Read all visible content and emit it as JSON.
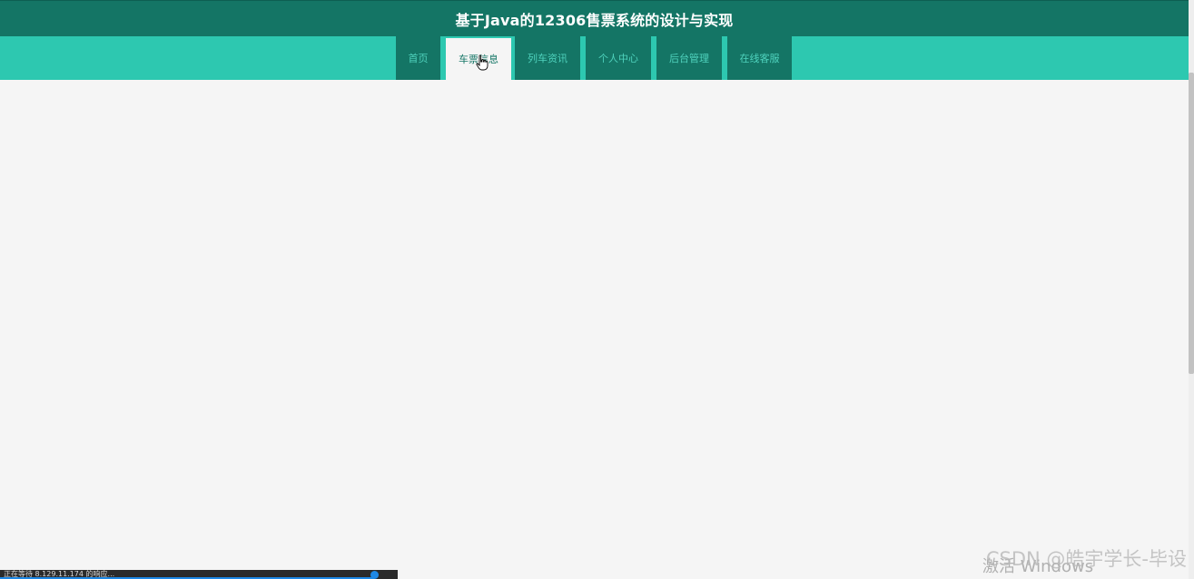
{
  "header": {
    "title": "基于Java的12306售票系统的设计与实现"
  },
  "nav": {
    "items": [
      {
        "label": "首页"
      },
      {
        "label": "车票信息"
      },
      {
        "label": "列车资讯"
      },
      {
        "label": "个人中心"
      },
      {
        "label": "后台管理"
      },
      {
        "label": "在线客服"
      }
    ],
    "active_index": 1
  },
  "status": {
    "text": "正在等待 8.129.11.174 的响应...",
    "progress_percent": 94
  },
  "overlay": {
    "activation_text": "激活 Windows",
    "watermark_text": "CSDN @皓宇学长-毕设"
  },
  "colors": {
    "header_bg": "#147565",
    "nav_bg": "#2dc8b0",
    "nav_item_bg": "#147565",
    "active_bg": "#f5f5f5",
    "page_bg": "#f5f5f5"
  }
}
